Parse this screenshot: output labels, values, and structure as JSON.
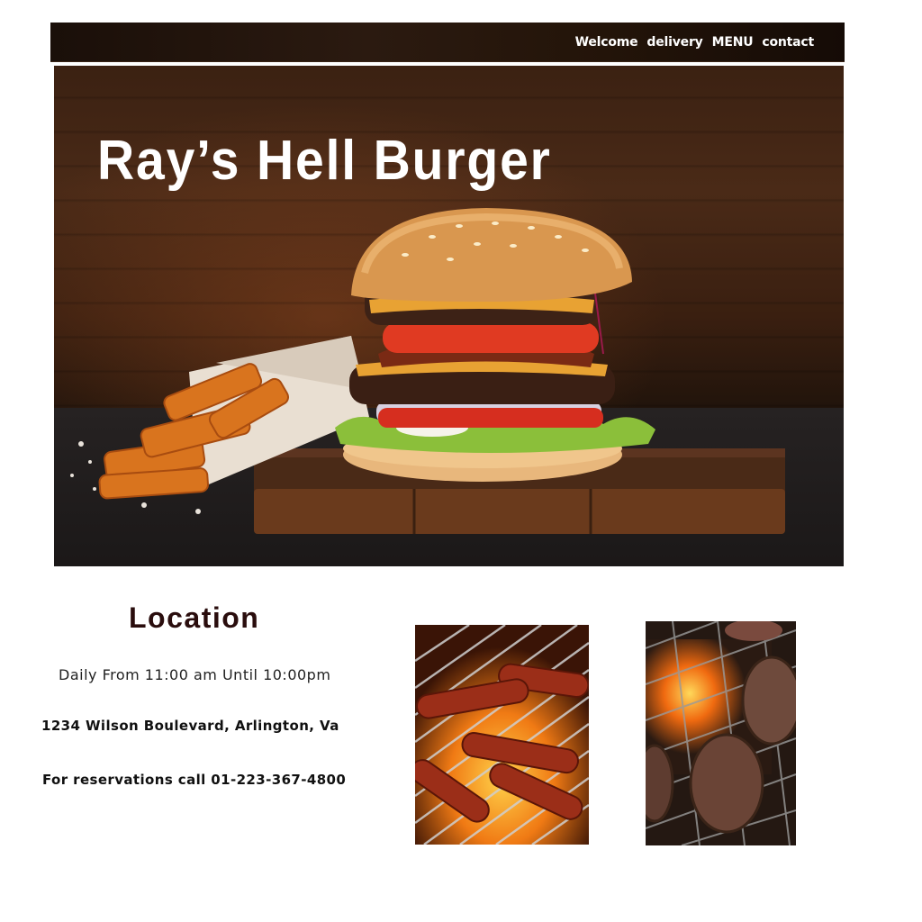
{
  "nav": {
    "items": [
      {
        "label": "Welcome"
      },
      {
        "label": "delivery"
      },
      {
        "label": "MENU"
      },
      {
        "label": "contact"
      }
    ]
  },
  "hero": {
    "title": "Ray’s Hell Burger",
    "image_subject": "double cheeseburger with fries on a wooden board"
  },
  "location": {
    "heading": "Location",
    "hours": "Daily From 11:00 am Until 10:00pm",
    "address": "1234 Wilson Boulevard, Arlington, Va",
    "phone": "For reservations call 01-223-367-4800"
  },
  "photos": [
    {
      "subject": "sausages on a flaming grill"
    },
    {
      "subject": "burger patties on a flaming grill"
    }
  ],
  "colors": {
    "nav_bg": "#231409",
    "nav_text": "#ffffff",
    "heading": "#2a0d0d",
    "body_text": "#111111"
  }
}
